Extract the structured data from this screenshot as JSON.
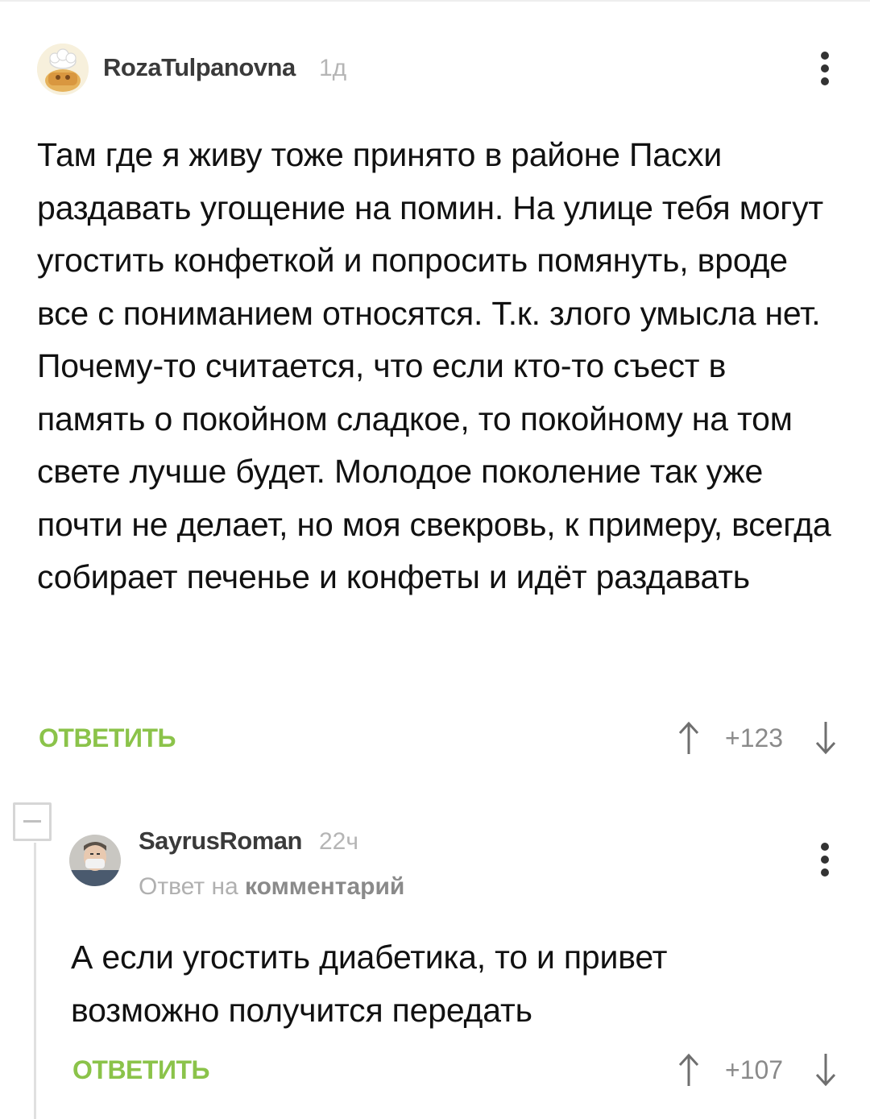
{
  "comments": [
    {
      "username": "RozaTulpanovna",
      "time": "1д",
      "avatar_icon": "chef-avatar-icon",
      "text": "Там где я живу тоже принято в районе Пасхи раздавать угощение на помин. На улице тебя могут угостить конфеткой и попросить помянуть, вроде все с пониманием относятся. Т.к. злого умысла нет. Почему-то считается, что если кто-то съест в память о покойном сладкое, то покойному на том свете лучше будет. Молодое поколение так уже почти не делает, но моя свекровь, к примеру, всегда собирает печенье и конфеты и идёт раздавать",
      "reply_label": "ОТВЕТИТЬ",
      "score": "+123"
    },
    {
      "username": "SayrusRoman",
      "time": "22ч",
      "avatar_icon": "masked-man-avatar-icon",
      "reply_to_prefix": "Ответ на",
      "reply_to_link": "комментарий",
      "text": "А если угостить диабетика, то и привет возможно получится передать",
      "reply_label": "ОТВЕТИТЬ",
      "score": "+107"
    }
  ],
  "colors": {
    "accent_green": "#8bc34a",
    "muted": "#b5b5b5",
    "text": "#111111"
  }
}
